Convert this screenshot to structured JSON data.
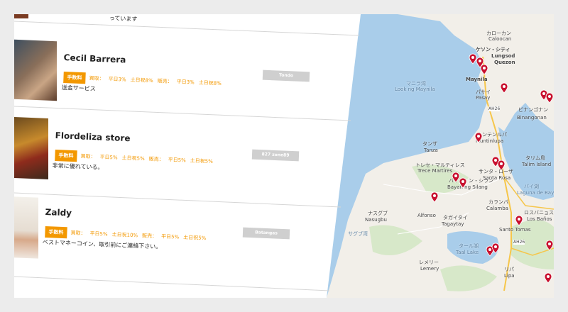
{
  "top_card": {
    "desc_partial": "っています"
  },
  "listings": [
    {
      "name": "Cecil Barrera",
      "fee_badge": "手数料",
      "buy_label": "買取：",
      "buy_weekday": "平日3%",
      "buy_weekend": "土日祝8%",
      "sell_label": "販売：",
      "sell_weekday": "平日3%",
      "sell_weekend": "土日祝8%",
      "description": "送金サービス",
      "location": "Tondo"
    },
    {
      "name": "Flordeliza store",
      "fee_badge": "手数料",
      "buy_label": "買取：",
      "buy_weekday": "平日5%",
      "buy_weekend": "土日祝5%",
      "sell_label": "販売：",
      "sell_weekday": "平日5%",
      "sell_weekend": "土日祝5%",
      "description": "非常に優れている。",
      "location": "827 zone89"
    },
    {
      "name": "Zaldy",
      "fee_badge": "手数料",
      "buy_label": "買取：",
      "buy_weekday": "平日5%",
      "buy_weekend": "土日祝10%",
      "sell_label": "販売：",
      "sell_weekday": "平日5%",
      "sell_weekend": "土日祝5%",
      "description": "ベストマネーコイン、取引前にご連絡下さい。",
      "location": "Batangas"
    }
  ],
  "map": {
    "labels": {
      "caloocan": "カローカン",
      "caloocan_en": "Caloocan",
      "quezon_jp": "ケソン・シティ",
      "lungsod": "Lungsod",
      "quezon": "Quezon",
      "maynila": "Maynila",
      "manila_bay_jp": "マニラ湾",
      "manila_bay": "Look ng Maynila",
      "pasay_jp": "パサイ",
      "pasay": "Pasay",
      "muntinlupa": "Muntinlupa",
      "muntinlupa_jp": "ムンテンルパ",
      "binangonan_jp": "ビナンゴナン",
      "binangonan": "Binangonan",
      "tanza_jp": "タンザ",
      "tanza": "Tanza",
      "trece_jp": "トレセ・マルティレス",
      "trece": "Trece Martires",
      "santa_rosa_jp": "サンタ・ローザ",
      "santa_rosa": "Santa Rosa",
      "silang_jp": "バヤン・ン・シラン",
      "silang": "Bayan ng Silang",
      "talim": "タリム島",
      "talim_en": "Talim Island",
      "laguna_bay_jp": "バイ湖",
      "laguna_bay": "Laguna de Bay",
      "calamba_jp": "カランバ",
      "calamba": "Calamba",
      "los_banos_jp": "ロスバニョス",
      "los_banos": "Los Baños",
      "alfonso": "Alfonso",
      "tagaytay_jp": "タガイタイ",
      "tagaytay": "Tagaytay",
      "santo_tomas": "Santo Tomas",
      "nasugbu_jp": "ナスグブ",
      "nasugbu": "Nasugbu",
      "taal_jp": "タール湖",
      "taal": "Taal Lake",
      "lemery_jp": "レメリー",
      "lemery": "Lemery",
      "lipa_jp": "リパ",
      "lipa": "Lipa",
      "bay_jp": "サグブ湾",
      "ah26_a": "AH26",
      "ah26_b": "AH26"
    },
    "colors": {
      "water": "#a9cdea",
      "land": "#f2efe9",
      "pin": "#c8102e"
    }
  }
}
